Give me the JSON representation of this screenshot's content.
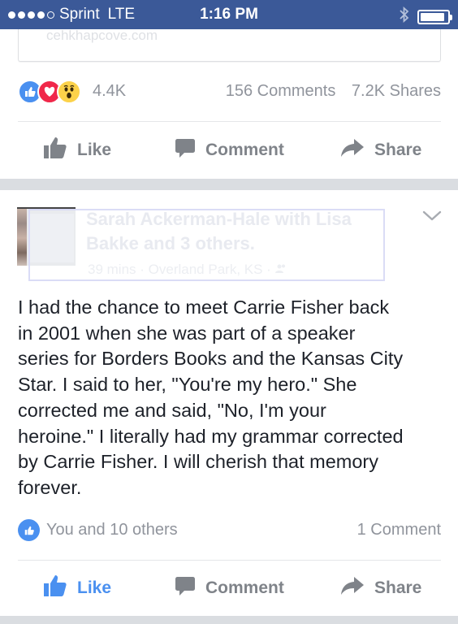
{
  "status_bar": {
    "carrier": "Sprint",
    "network": "LTE",
    "time": "1:16 PM",
    "signal_bars": 4,
    "signal_max": 5,
    "battery_level": 0.9
  },
  "colors": {
    "status_bar_bg": "#3b5998",
    "facebook_blue": "#4a90f0",
    "love_red": "#f0284a",
    "wow_yellow": "#fcd24a",
    "muted_text": "#90949c",
    "action_gray": "#7f8389",
    "separator": "#dadde1"
  },
  "prev_post": {
    "link_domain": "cehkhapcove.com",
    "reactions": [
      "like-icon",
      "love-icon",
      "wow-icon"
    ],
    "reaction_count": "4.4K",
    "comments": "156 Comments",
    "shares": "7.2K Shares",
    "actions": {
      "like": "Like",
      "comment": "Comment",
      "share": "Share"
    }
  },
  "post": {
    "author": "Sarah Ackerman-Hale",
    "with_text": "with Lisa",
    "author_line2": "Bakke and 3 others.",
    "time_ago": "39 mins",
    "location": "Overland Park, KS",
    "body": "I had the chance to meet Carrie Fisher back in 2001 when she was part of a speaker series for Borders Books and the Kansas City Star. I said to her, \"You're my hero.\" She corrected me and said, \"No, I'm your heroine.\" I literally had my grammar corrected by Carrie Fisher. I will cherish that memory forever.",
    "body_lines": [
      "I had the chance to meet Carrie Fisher back",
      "in 2001 when she was part of a speaker",
      "series for Borders Books and the Kansas City",
      "Star. I said to her, \"You're my hero.\" She",
      "corrected me and said, \"No, I'm your",
      "heroine.\" I literally had my grammar corrected",
      "by Carrie Fisher. I will cherish that memory",
      "forever."
    ],
    "likes_text": "You and 10 others",
    "comments_text": "1 Comment",
    "liked": true,
    "actions": {
      "like": "Like",
      "comment": "Comment",
      "share": "Share"
    }
  }
}
